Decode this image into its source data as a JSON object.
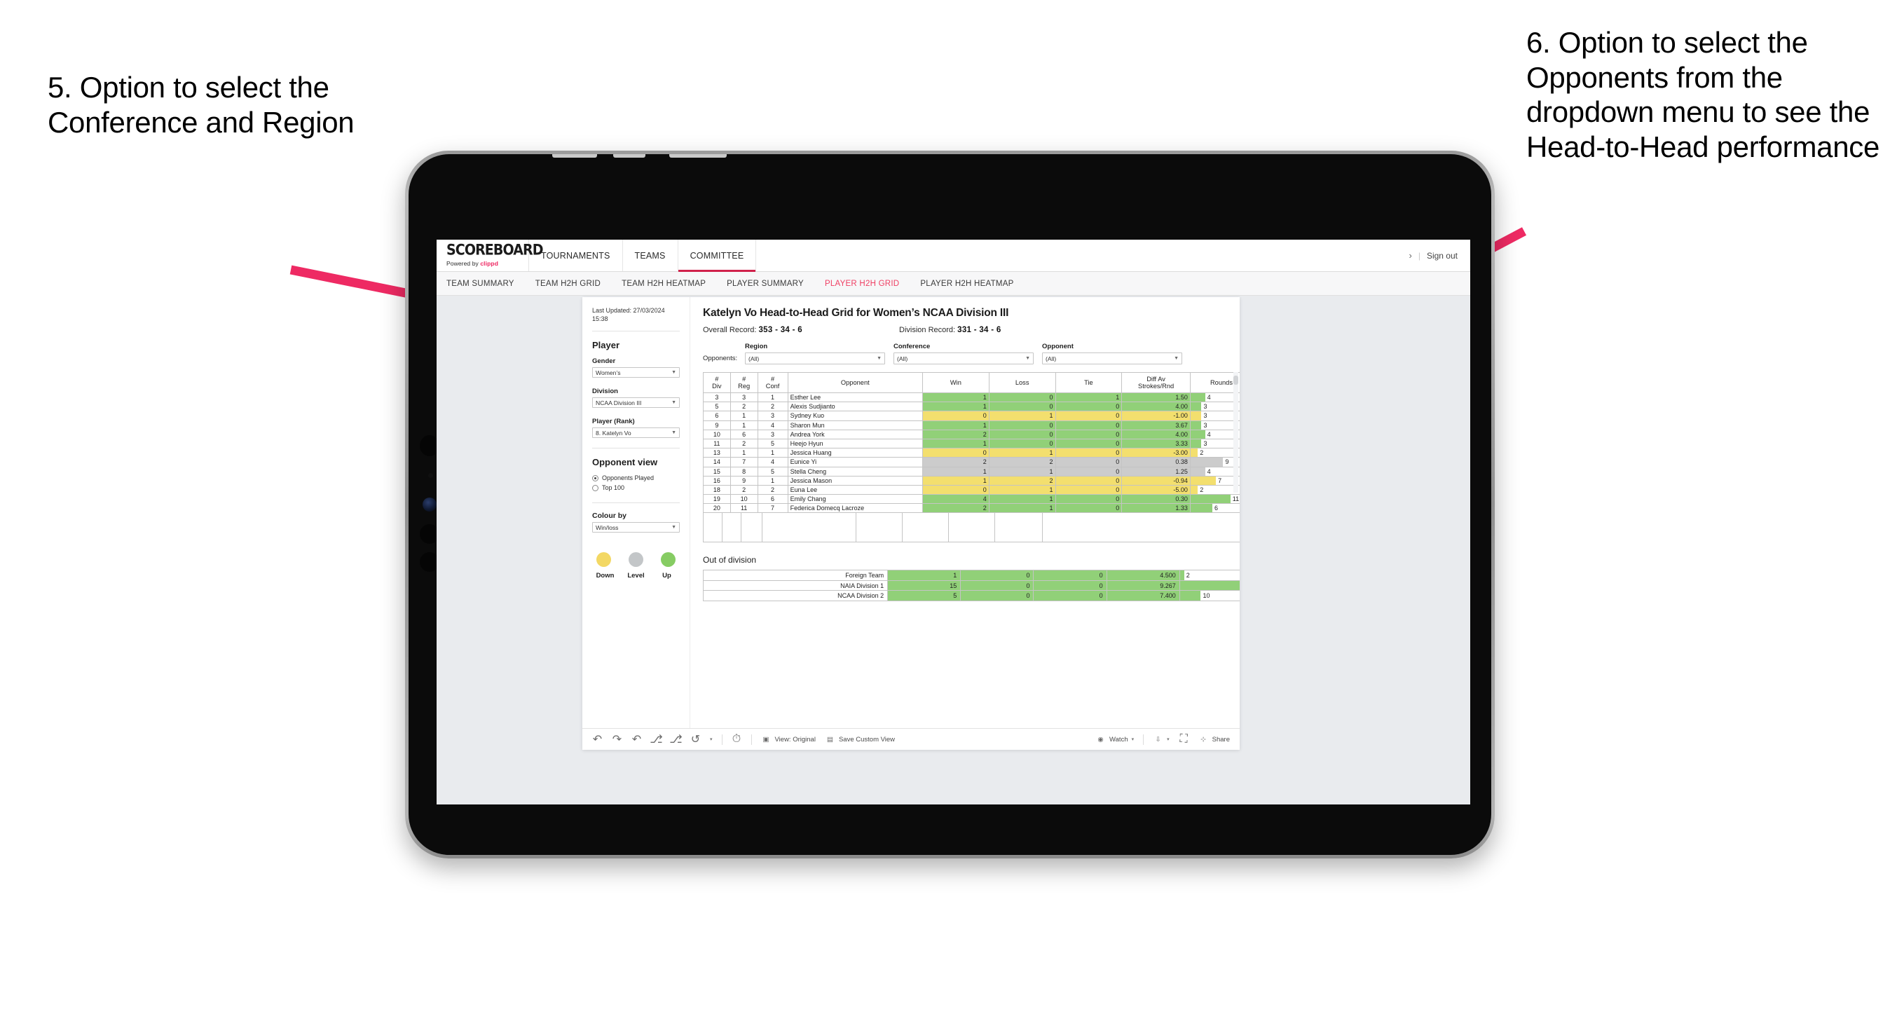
{
  "annotations": {
    "left": "5. Option to select the Conference and Region",
    "right": "6. Option to select the Opponents from the dropdown menu to see the Head-to-Head performance",
    "arrow_color": "#EE2A63"
  },
  "header": {
    "brand_title": "SCOREBOARD",
    "brand_sub_prefix": "Powered by ",
    "brand_sub_brand": "clippd",
    "nav": [
      {
        "label": "TOURNAMENTS",
        "active": false
      },
      {
        "label": "TEAMS",
        "active": false
      },
      {
        "label": "COMMITTEE",
        "active": true
      }
    ],
    "chevron": "›",
    "divider": "|",
    "sign_out": "Sign out"
  },
  "subtabs": [
    {
      "label": "TEAM SUMMARY",
      "active": false
    },
    {
      "label": "TEAM H2H GRID",
      "active": false
    },
    {
      "label": "TEAM H2H HEATMAP",
      "active": false
    },
    {
      "label": "PLAYER SUMMARY",
      "active": false
    },
    {
      "label": "PLAYER H2H GRID",
      "active": true
    },
    {
      "label": "PLAYER H2H HEATMAP",
      "active": false
    }
  ],
  "sidebar": {
    "last_updated": "Last Updated: 27/03/2024 15:38",
    "player_heading": "Player",
    "gender_label": "Gender",
    "gender_value": "Women’s",
    "division_label": "Division",
    "division_value": "NCAA Division III",
    "player_rank_label": "Player (Rank)",
    "player_rank_value": "8. Katelyn Vo",
    "opponent_view_heading": "Opponent view",
    "opponent_view_options": [
      {
        "label": "Opponents Played",
        "selected": true
      },
      {
        "label": "Top 100",
        "selected": false
      }
    ],
    "colour_by_label": "Colour by",
    "colour_by_value": "Win/loss",
    "legend": [
      {
        "label": "Down",
        "color": "#F3D864"
      },
      {
        "label": "Level",
        "color": "#C3C6C8"
      },
      {
        "label": "Up",
        "color": "#86CC63"
      }
    ]
  },
  "viz": {
    "title": "Katelyn Vo Head-to-Head Grid for Women’s NCAA Division III",
    "overall_record_label": "Overall Record:",
    "overall_record_value": "353 -  34 - 6",
    "division_record_label": "Division Record:",
    "division_record_value": "331 -  34 - 6",
    "filters_lead": "Opponents:",
    "filters": [
      {
        "label": "Region",
        "value": "(All)"
      },
      {
        "label": "Conference",
        "value": "(All)"
      },
      {
        "label": "Opponent",
        "value": "(All)"
      }
    ],
    "out_of_division_title": "Out of division"
  },
  "chart_data": {
    "type": "table",
    "title": "Katelyn Vo Head-to-Head Grid for Women’s NCAA Division III",
    "columns": [
      "# Div",
      "# Reg",
      "# Conf",
      "Opponent",
      "Win",
      "Loss",
      "Tie",
      "Diff Av Strokes/Rnd",
      "Rounds"
    ],
    "header_lines": {
      "div": [
        "#",
        "Div"
      ],
      "reg": [
        "#",
        "Reg"
      ],
      "conf": [
        "#",
        "Conf"
      ],
      "opponent": [
        "Opponent"
      ],
      "win": [
        "Win"
      ],
      "loss": [
        "Loss"
      ],
      "tie": [
        "Tie"
      ],
      "diff": [
        "Diff Av",
        "Strokes/Rnd"
      ],
      "rounds": [
        "Rounds"
      ]
    },
    "rounds_max": 12,
    "rows": [
      {
        "div": "3",
        "reg": "3",
        "conf": "1",
        "opponent": "Esther Lee",
        "win": "1",
        "loss": "0",
        "tie": "1",
        "diff": "1.50",
        "rounds": "4",
        "color": "#91D078"
      },
      {
        "div": "5",
        "reg": "2",
        "conf": "2",
        "opponent": "Alexis Sudjianto",
        "win": "1",
        "loss": "0",
        "tie": "0",
        "diff": "4.00",
        "rounds": "3",
        "color": "#91D078"
      },
      {
        "div": "6",
        "reg": "1",
        "conf": "3",
        "opponent": "Sydney Kuo",
        "win": "0",
        "loss": "1",
        "tie": "0",
        "diff": "-1.00",
        "rounds": "3",
        "color": "#F3DF6E"
      },
      {
        "div": "9",
        "reg": "1",
        "conf": "4",
        "opponent": "Sharon Mun",
        "win": "1",
        "loss": "0",
        "tie": "0",
        "diff": "3.67",
        "rounds": "3",
        "color": "#91D078"
      },
      {
        "div": "10",
        "reg": "6",
        "conf": "3",
        "opponent": "Andrea York",
        "win": "2",
        "loss": "0",
        "tie": "0",
        "diff": "4.00",
        "rounds": "4",
        "color": "#91D078"
      },
      {
        "div": "11",
        "reg": "2",
        "conf": "5",
        "opponent": "Heejo Hyun",
        "win": "1",
        "loss": "0",
        "tie": "0",
        "diff": "3.33",
        "rounds": "3",
        "color": "#91D078"
      },
      {
        "div": "13",
        "reg": "1",
        "conf": "1",
        "opponent": "Jessica Huang",
        "win": "0",
        "loss": "1",
        "tie": "0",
        "diff": "-3.00",
        "rounds": "2",
        "color": "#F3DF6E"
      },
      {
        "div": "14",
        "reg": "7",
        "conf": "4",
        "opponent": "Eunice Yi",
        "win": "2",
        "loss": "2",
        "tie": "0",
        "diff": "0.38",
        "rounds": "9",
        "color": "#CCCCCC"
      },
      {
        "div": "15",
        "reg": "8",
        "conf": "5",
        "opponent": "Stella Cheng",
        "win": "1",
        "loss": "1",
        "tie": "0",
        "diff": "1.25",
        "rounds": "4",
        "color": "#CCCCCC"
      },
      {
        "div": "16",
        "reg": "9",
        "conf": "1",
        "opponent": "Jessica Mason",
        "win": "1",
        "loss": "2",
        "tie": "0",
        "diff": "-0.94",
        "rounds": "7",
        "color": "#F3DF6E"
      },
      {
        "div": "18",
        "reg": "2",
        "conf": "2",
        "opponent": "Euna Lee",
        "win": "0",
        "loss": "1",
        "tie": "0",
        "diff": "-5.00",
        "rounds": "2",
        "color": "#F3DF6E"
      },
      {
        "div": "19",
        "reg": "10",
        "conf": "6",
        "opponent": "Emily Chang",
        "win": "4",
        "loss": "1",
        "tie": "0",
        "diff": "0.30",
        "rounds": "11",
        "color": "#91D078"
      },
      {
        "div": "20",
        "reg": "11",
        "conf": "7",
        "opponent": "Federica Domecq Lacroze",
        "win": "2",
        "loss": "1",
        "tie": "0",
        "diff": "1.33",
        "rounds": "6",
        "color": "#91D078"
      }
    ],
    "out_of_division": {
      "rounds_max": 32,
      "rows": [
        {
          "name": "Foreign Team",
          "win": "1",
          "loss": "0",
          "tie": "0",
          "diff": "4.500",
          "rounds": "2",
          "color": "#91D078"
        },
        {
          "name": "NAIA Division 1",
          "win": "15",
          "loss": "0",
          "tie": "0",
          "diff": "9.267",
          "rounds": "30",
          "color": "#91D078"
        },
        {
          "name": "NCAA Division 2",
          "win": "5",
          "loss": "0",
          "tie": "0",
          "diff": "7.400",
          "rounds": "10",
          "color": "#91D078"
        }
      ]
    }
  },
  "toolbar": {
    "icons": [
      "undo-icon",
      "redo-icon",
      "revert-icon",
      "refresh-icon",
      "pause-icon",
      "back-icon"
    ],
    "view_label": "View: Original",
    "save_label": "Save Custom View",
    "watch_label": "Watch",
    "share_label": "Share",
    "caret": "▾"
  }
}
